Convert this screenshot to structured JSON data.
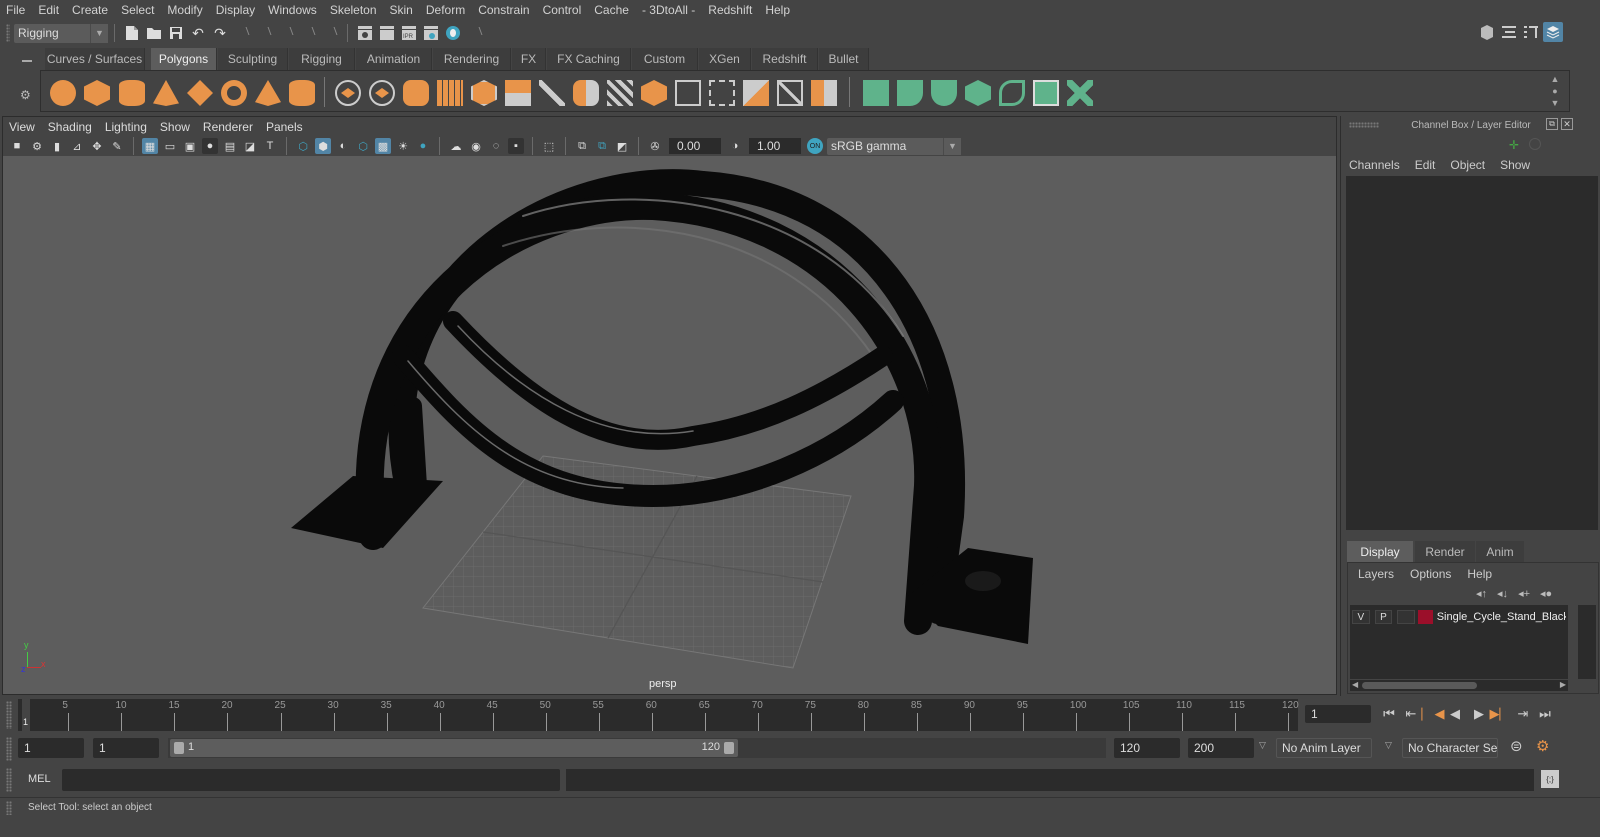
{
  "menubar": {
    "items": [
      "File",
      "Edit",
      "Create",
      "Select",
      "Modify",
      "Display",
      "Windows",
      "Skeleton",
      "Skin",
      "Deform",
      "Constrain",
      "Control",
      "Cache",
      "- 3DtoAll -",
      "Redshift",
      "Help"
    ]
  },
  "statusline": {
    "menuset": "Rigging"
  },
  "shelf": {
    "tabs": [
      "Curves / Surfaces",
      "Polygons",
      "Sculpting",
      "Rigging",
      "Animation",
      "Rendering",
      "FX",
      "FX Caching",
      "Custom",
      "XGen",
      "Redshift",
      "Bullet"
    ],
    "active_tab": "Polygons"
  },
  "viewport": {
    "menu": [
      "View",
      "Shading",
      "Lighting",
      "Show",
      "Renderer",
      "Panels"
    ],
    "exposure": "0.00",
    "gamma": "1.00",
    "color_space": "sRGB gamma",
    "camera_label": "persp",
    "axis_labels": {
      "x": "x",
      "y": "y",
      "z": "z"
    }
  },
  "channel_box": {
    "title": "Channel Box / Layer Editor",
    "menu": [
      "Channels",
      "Edit",
      "Object",
      "Show"
    ]
  },
  "layer_editor": {
    "tabs": [
      "Display",
      "Render",
      "Anim"
    ],
    "active_tab": "Display",
    "menu": [
      "Layers",
      "Options",
      "Help"
    ],
    "layers": [
      {
        "v": "V",
        "p": "P",
        "color": "#9b0f2a",
        "name": "Single_Cycle_Stand_Black"
      }
    ]
  },
  "timeline": {
    "ticks": [
      "5",
      "10",
      "15",
      "20",
      "25",
      "30",
      "35",
      "40",
      "45",
      "50",
      "55",
      "60",
      "65",
      "70",
      "75",
      "80",
      "85",
      "90",
      "95",
      "100",
      "105",
      "110",
      "115",
      "120"
    ],
    "current_frame_marker": "1",
    "current_frame": "1"
  },
  "range": {
    "start": "1",
    "playback_start": "1",
    "slider_start": "1",
    "slider_end": "120",
    "playback_end": "120",
    "end": "200",
    "anim_layer": "No Anim Layer",
    "character_set": "No Character Set"
  },
  "command_line": {
    "language": "MEL"
  },
  "help_line": {
    "text": "Select Tool: select an object"
  }
}
